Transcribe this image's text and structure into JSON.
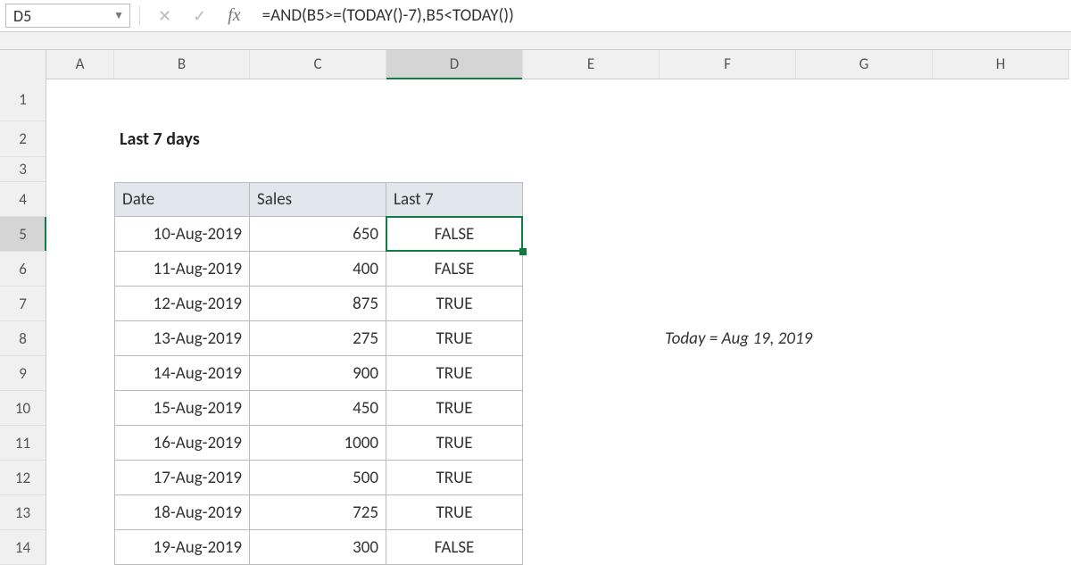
{
  "name_box": {
    "value": "D5"
  },
  "formula_bar": {
    "fx_label": "fx",
    "value": "=AND(B5>=(TODAY()-7),B5<TODAY())"
  },
  "columns": [
    "A",
    "B",
    "C",
    "D",
    "E",
    "F",
    "G",
    "H"
  ],
  "active_col_index": 3,
  "active_row_index": 5,
  "row_numbers": [
    "1",
    "2",
    "3",
    "4",
    "5",
    "6",
    "7",
    "8",
    "9",
    "10",
    "11",
    "12",
    "13",
    "14"
  ],
  "title": "Last 7 days",
  "table": {
    "headers": {
      "date": "Date",
      "sales": "Sales",
      "last7": "Last 7"
    },
    "rows": [
      {
        "date": "10-Aug-2019",
        "sales": "650",
        "last7": "FALSE"
      },
      {
        "date": "11-Aug-2019",
        "sales": "400",
        "last7": "FALSE"
      },
      {
        "date": "12-Aug-2019",
        "sales": "875",
        "last7": "TRUE"
      },
      {
        "date": "13-Aug-2019",
        "sales": "275",
        "last7": "TRUE"
      },
      {
        "date": "14-Aug-2019",
        "sales": "900",
        "last7": "TRUE"
      },
      {
        "date": "15-Aug-2019",
        "sales": "450",
        "last7": "TRUE"
      },
      {
        "date": "16-Aug-2019",
        "sales": "1000",
        "last7": "TRUE"
      },
      {
        "date": "17-Aug-2019",
        "sales": "500",
        "last7": "TRUE"
      },
      {
        "date": "18-Aug-2019",
        "sales": "725",
        "last7": "TRUE"
      },
      {
        "date": "19-Aug-2019",
        "sales": "300",
        "last7": "FALSE"
      }
    ]
  },
  "note": "Today = Aug 19, 2019"
}
